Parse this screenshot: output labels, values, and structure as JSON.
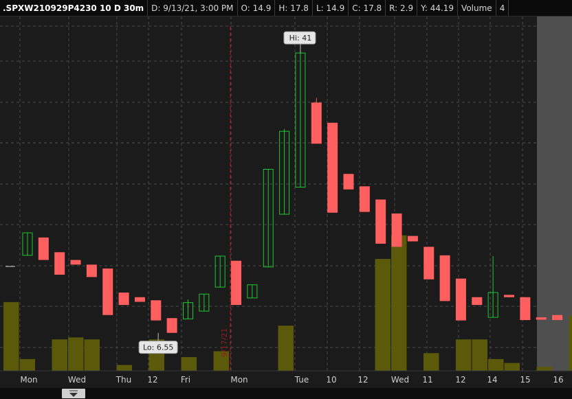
{
  "header": {
    "symbol": ".SPXW210929P4230 10 D 30m",
    "date": "D: 9/13/21, 3:00 PM",
    "open": "O: 14.9",
    "high": "H: 17.8",
    "low": "L: 14.9",
    "close": "C: 17.8",
    "range": "R: 2.9",
    "y": "Y: 44.19",
    "study": "Volume",
    "study_value": "4"
  },
  "colors": {
    "up": "#1ec931",
    "down": "#ff5f5f",
    "volume": "#5a5a0a",
    "background": "#1b1b1b",
    "grid": "#4a4a4a",
    "marker": "#b81d1d",
    "expansion": "#5d5d5d"
  },
  "markers": {
    "session_date": "9/17/21",
    "hi_label": "Hi: 41",
    "lo_label": "Lo: 6.55"
  },
  "scrollbar": {
    "icon": "scroll-handle-icon"
  },
  "chart_data": {
    "type": "candlestick",
    "x_labels": [
      "Mon",
      "Wed",
      "Thu",
      "12",
      "Fri",
      "Mon",
      "Tue",
      "10",
      "12",
      "Wed",
      "11",
      "12",
      "14",
      "15",
      "16"
    ],
    "y_range": [
      0,
      45
    ],
    "grid": true,
    "candles": [
      {
        "o": 14.9,
        "h": 17.8,
        "l": 14.9,
        "c": 17.8
      },
      {
        "o": 17.2,
        "h": 17.2,
        "l": 14.3,
        "c": 14.3
      },
      {
        "o": 15.3,
        "h": 15.3,
        "l": 12.4,
        "c": 12.4
      },
      {
        "o": 14.3,
        "h": 14.3,
        "l": 13.7,
        "c": 13.7
      },
      {
        "o": 13.7,
        "h": 13.7,
        "l": 12.1,
        "c": 12.1
      },
      {
        "o": 13.2,
        "h": 13.2,
        "l": 7.2,
        "c": 7.2
      },
      {
        "o": 10.1,
        "h": 10.1,
        "l": 8.5,
        "c": 8.5
      },
      {
        "o": 9.5,
        "h": 9.5,
        "l": 8.9,
        "c": 8.9
      },
      {
        "o": 9.1,
        "h": 9.1,
        "l": 6.5,
        "c": 6.5
      },
      {
        "o": 6.8,
        "h": 6.8,
        "l": 4.9,
        "c": 4.9
      },
      {
        "o": 6.7,
        "h": 9.2,
        "l": 6.7,
        "c": 8.8
      },
      {
        "o": 7.7,
        "h": 9.9,
        "l": 7.7,
        "c": 9.9
      },
      {
        "o": 10.8,
        "h": 14.8,
        "l": 10.8,
        "c": 14.8
      },
      {
        "o": 14.2,
        "h": 14.2,
        "l": 8.5,
        "c": 8.5
      },
      {
        "o": 9.4,
        "h": 11.1,
        "l": 9.4,
        "c": 11.1
      },
      {
        "o": 13.4,
        "h": 26.0,
        "l": 13.4,
        "c": 26.0
      },
      {
        "o": 20.2,
        "h": 31.2,
        "l": 20.2,
        "c": 30.9
      },
      {
        "o": 23.7,
        "h": 41.0,
        "l": 23.7,
        "c": 41.0
      },
      {
        "o": 34.6,
        "h": 35.2,
        "l": 29.3,
        "c": 29.3
      },
      {
        "o": 32.0,
        "h": 32.0,
        "l": 20.4,
        "c": 20.4
      },
      {
        "o": 25.4,
        "h": 25.4,
        "l": 23.4,
        "c": 23.4
      },
      {
        "o": 23.8,
        "h": 23.8,
        "l": 20.5,
        "c": 20.5
      },
      {
        "o": 22.1,
        "h": 22.1,
        "l": 16.4,
        "c": 16.4
      },
      {
        "o": 20.3,
        "h": 20.3,
        "l": 16.0,
        "c": 16.0
      },
      {
        "o": 17.4,
        "h": 17.4,
        "l": 16.7,
        "c": 16.7
      },
      {
        "o": 16.0,
        "h": 16.0,
        "l": 11.8,
        "c": 11.8
      },
      {
        "o": 14.9,
        "h": 14.9,
        "l": 9.0,
        "c": 9.0
      },
      {
        "o": 11.9,
        "h": 11.9,
        "l": 6.5,
        "c": 6.5
      },
      {
        "o": 9.5,
        "h": 9.5,
        "l": 8.5,
        "c": 8.5
      },
      {
        "o": 6.9,
        "h": 14.8,
        "l": 6.9,
        "c": 10.1
      },
      {
        "o": 9.8,
        "h": 9.8,
        "l": 9.5,
        "c": 9.5
      },
      {
        "o": 9.5,
        "h": 9.5,
        "l": 6.55,
        "c": 6.55
      },
      {
        "o": 6.9,
        "h": 6.9,
        "l": 6.6,
        "c": 6.6
      },
      {
        "o": 7.2,
        "h": 7.2,
        "l": 6.55,
        "c": 6.55
      }
    ],
    "volume_range": [
      0,
      100
    ],
    "volume": [
      35,
      6,
      0,
      16,
      17,
      16,
      0,
      3,
      0,
      16,
      0,
      7,
      0,
      10,
      0,
      0,
      0,
      23,
      0,
      0,
      0,
      0,
      0,
      57,
      69,
      0,
      9,
      0,
      16,
      16,
      6,
      4,
      0,
      2,
      0,
      28,
      14,
      6,
      24,
      49,
      32
    ]
  }
}
